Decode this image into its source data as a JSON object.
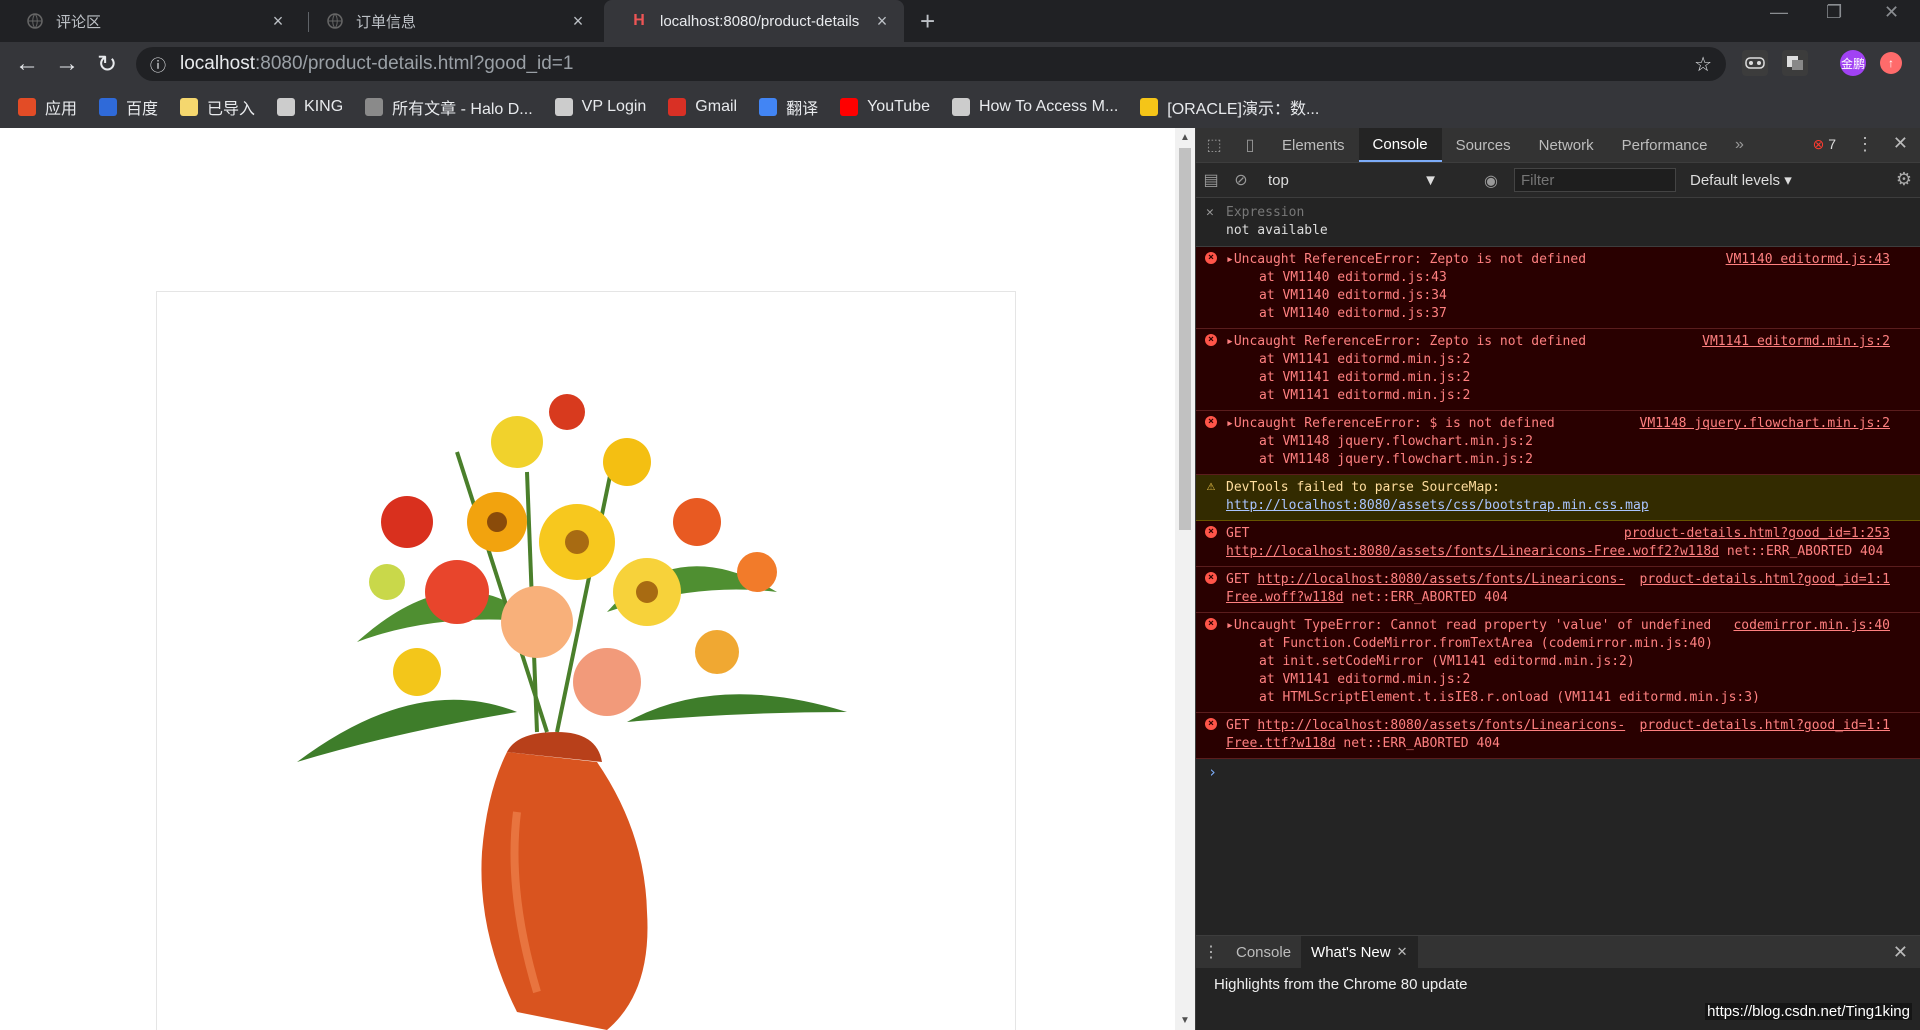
{
  "tabs": [
    {
      "title": "评论区",
      "active": false
    },
    {
      "title": "订单信息",
      "active": false
    },
    {
      "title": "localhost:8080/product-details",
      "active": true
    }
  ],
  "address": {
    "host": "localhost",
    "rest": ":8080/product-details.html?good_id=1"
  },
  "bookmarks": [
    {
      "label": "应用",
      "icon": "apps-grid-icon",
      "color": "#e34c26"
    },
    {
      "label": "百度",
      "icon": "baidu-icon",
      "color": "#2f6ad9"
    },
    {
      "label": "已导入",
      "icon": "folder-icon",
      "color": "#f5d76e"
    },
    {
      "label": "KING",
      "icon": "globe-icon",
      "color": "#cccccc"
    },
    {
      "label": "所有文章 - Halo D...",
      "icon": "halo-icon",
      "color": "#8a8a8a"
    },
    {
      "label": "VP Login",
      "icon": "globe-icon",
      "color": "#cccccc"
    },
    {
      "label": "Gmail",
      "icon": "gmail-icon",
      "color": "#d93025"
    },
    {
      "label": "翻译",
      "icon": "translate-icon",
      "color": "#4285f4"
    },
    {
      "label": "YouTube",
      "icon": "youtube-icon",
      "color": "#ff0000"
    },
    {
      "label": "How To Access M...",
      "icon": "p-icon",
      "color": "#cccccc"
    },
    {
      "label": "[ORACLE]演示：数...",
      "icon": "oracle-icon",
      "color": "#f5c518"
    }
  ],
  "extensions": {
    "avatar_label": "金鹏"
  },
  "devtools": {
    "tabs": [
      "Elements",
      "Console",
      "Sources",
      "Network",
      "Performance"
    ],
    "active_tab": "Console",
    "error_count": "7",
    "context": "top",
    "filter_placeholder": "Filter",
    "levels": "Default levels",
    "expression": {
      "label": "Expression",
      "value": "not available"
    },
    "messages": [
      {
        "type": "error",
        "text": "Uncaught ReferenceError: Zepto is not defined",
        "source": "VM1140 editormd.js:43",
        "stack": [
          "at VM1140 editormd.js:43",
          "at VM1140 editormd.js:34",
          "at VM1140 editormd.js:37"
        ]
      },
      {
        "type": "error",
        "text": "Uncaught ReferenceError: Zepto is not defined",
        "source": "VM1141 editormd.min.js:2",
        "stack": [
          "at VM1141 editormd.min.js:2",
          "at VM1141 editormd.min.js:2",
          "at VM1141 editormd.min.js:2"
        ]
      },
      {
        "type": "error",
        "text": "Uncaught ReferenceError: $ is not defined",
        "source": "VM1148 jquery.flowchart.min.js:2",
        "stack": [
          "at VM1148 jquery.flowchart.min.js:2",
          "at VM1148 jquery.flowchart.min.js:2"
        ]
      },
      {
        "type": "warn",
        "text": "DevTools failed to parse SourceMap:",
        "link": "http://localhost:8080/assets/css/bootstrap.min.css.map"
      },
      {
        "type": "error",
        "prefix": "GET",
        "link": "http://localhost:8080/assets/fonts/Linearicons-Free.woff2?w118d",
        "suffix": "net::ERR_ABORTED 404",
        "source": "product-details.html?good_id=1:253"
      },
      {
        "type": "error",
        "prefix": "GET",
        "link": "http://localhost:8080/assets/fonts/Linearicons-Free.woff?w118d",
        "suffix": "net::ERR_ABORTED 404",
        "source": "product-details.html?good_id=1:1"
      },
      {
        "type": "error",
        "text": "Uncaught TypeError: Cannot read property 'value' of undefined",
        "source": "codemirror.min.js:40",
        "stack": [
          "at Function.CodeMirror.fromTextArea (codemirror.min.js:40)",
          "at init.setCodeMirror (VM1141 editormd.min.js:2)",
          "at VM1141 editormd.min.js:2",
          "at HTMLScriptElement.t.isIE8.r.onload (VM1141 editormd.min.js:3)"
        ]
      },
      {
        "type": "error",
        "prefix": "GET",
        "link": "http://localhost:8080/assets/fonts/Linearicons-Free.ttf?w118d",
        "suffix": "net::ERR_ABORTED 404",
        "source": "product-details.html?good_id=1:1"
      }
    ],
    "drawer": {
      "tabs": [
        "Console",
        "What's New"
      ],
      "active": "What's New",
      "headline": "Highlights from the Chrome 80 update"
    }
  },
  "watermark": "https://blog.csdn.net/Ting1king"
}
